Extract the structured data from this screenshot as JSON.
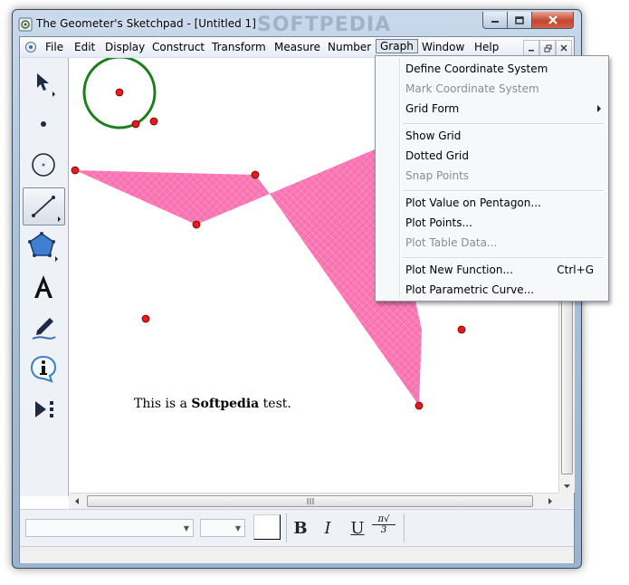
{
  "window": {
    "title": "The Geometer's Sketchpad - [Untitled 1]",
    "watermark": "SOFTPEDIA"
  },
  "menubar": {
    "items": [
      "File",
      "Edit",
      "Display",
      "Construct",
      "Transform",
      "Measure",
      "Number",
      "Graph",
      "Window",
      "Help"
    ],
    "active": "Graph"
  },
  "tools": [
    "arrow-tool",
    "point-tool",
    "compass-tool",
    "straightedge-tool",
    "polygon-tool",
    "text-tool",
    "marker-tool",
    "information-tool",
    "custom-tools"
  ],
  "canvas": {
    "text_prefix": "This is a ",
    "text_bold": "Softpedia",
    "text_suffix": " test.",
    "fill_color": "#ff5fb0",
    "point_color": "#e51a1a",
    "circle_color": "#1a7f1a"
  },
  "graph_menu": {
    "items": [
      {
        "label": "Define Coordinate System",
        "disabled": false
      },
      {
        "label": "Mark Coordinate System",
        "disabled": true
      },
      {
        "label": "Grid Form",
        "disabled": false,
        "submenu": true
      },
      {
        "label": "Show Grid",
        "disabled": false
      },
      {
        "label": "Dotted Grid",
        "disabled": false
      },
      {
        "label": "Snap Points",
        "disabled": true
      },
      {
        "label": "Plot Value on Pentagon...",
        "disabled": false
      },
      {
        "label": "Plot Points...",
        "disabled": false
      },
      {
        "label": "Plot Table Data...",
        "disabled": true
      },
      {
        "label": "Plot New Function...",
        "disabled": false,
        "shortcut": "Ctrl+G"
      },
      {
        "label": "Plot Parametric Curve...",
        "disabled": false
      }
    ]
  },
  "textbar": {
    "bold": "B",
    "italic": "I",
    "underline": "U",
    "math_numerator": "π√",
    "math_denominator": "3"
  }
}
